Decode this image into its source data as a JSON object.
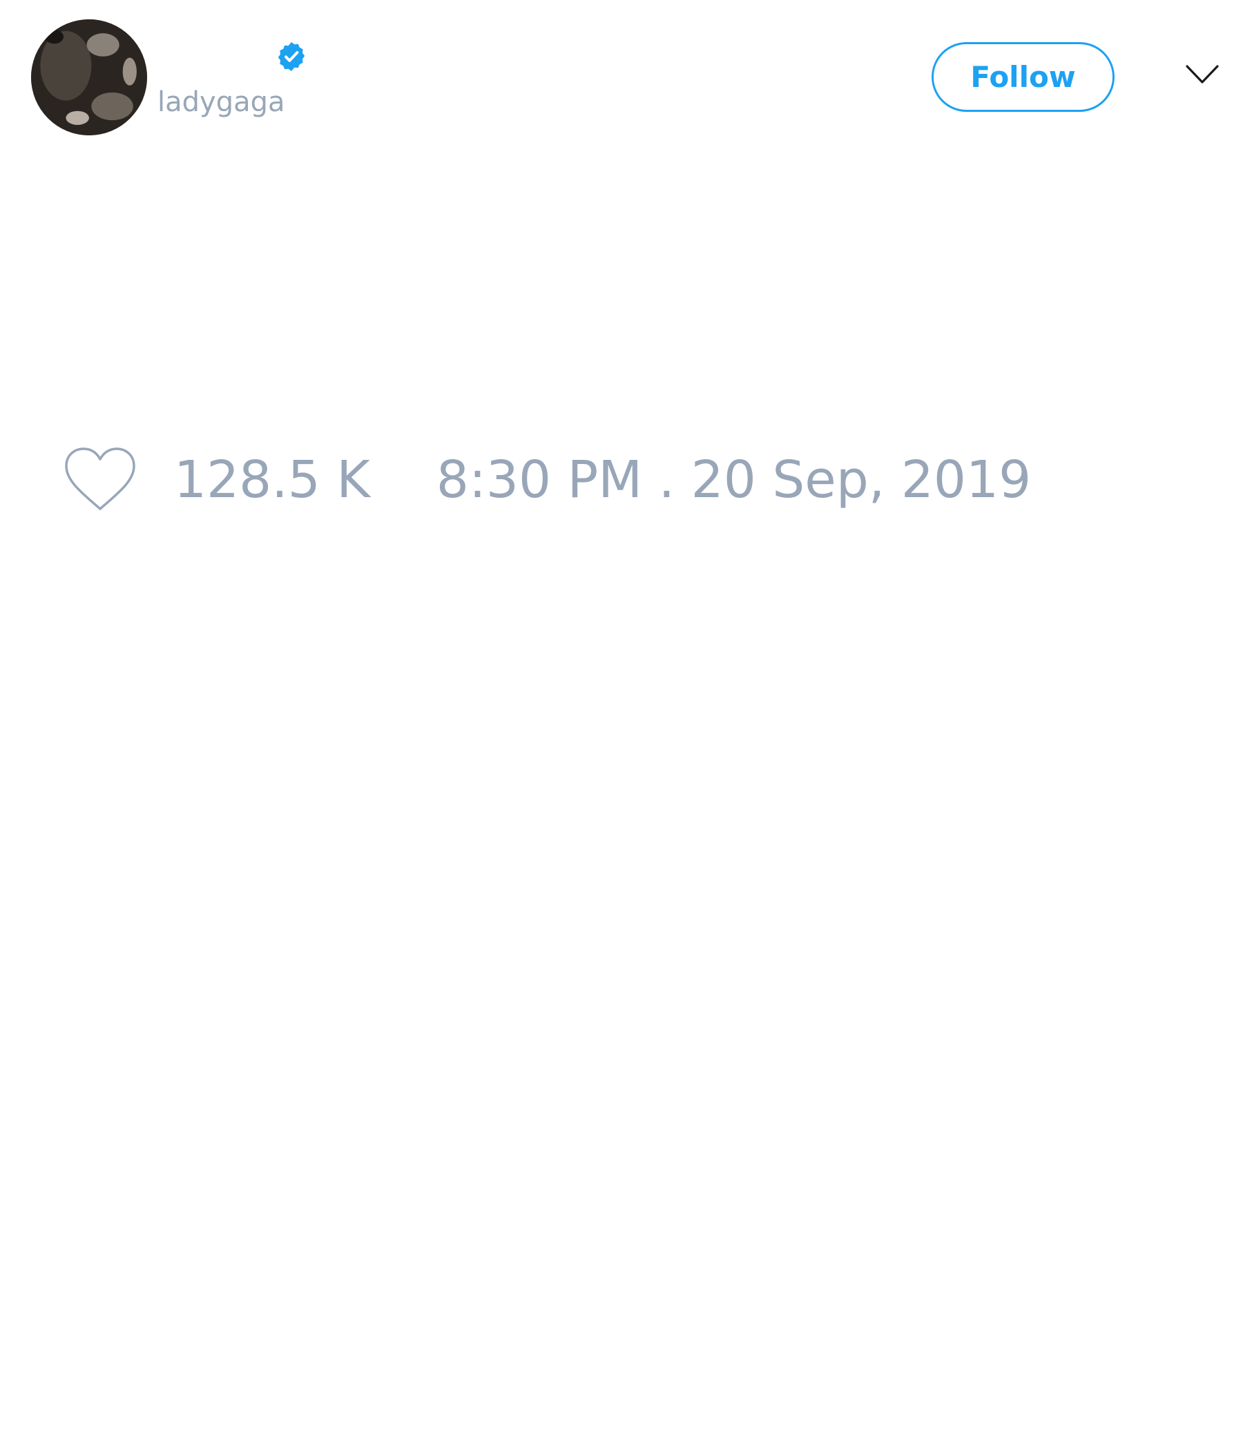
{
  "tweet": {
    "author": {
      "handle": "ladygaga",
      "verified": true,
      "avatar_icon": "profile-photo"
    },
    "follow_label": "Follow",
    "menu_icon": "chevron-down-icon",
    "likes": {
      "icon": "heart-icon",
      "count": "128.5 K"
    },
    "timestamp": "8:30 PM . 20 Sep, 2019"
  },
  "colors": {
    "accent": "#1da1f2",
    "muted_text": "#98a6b8",
    "background": "#ffffff"
  }
}
